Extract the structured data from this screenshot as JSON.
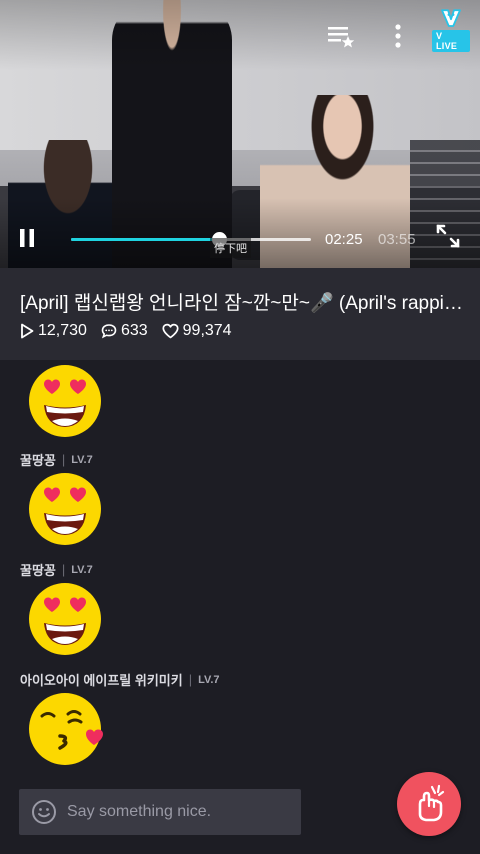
{
  "video": {
    "time_current": "02:25",
    "time_total": "03:55",
    "progress": 0.617,
    "subtitle": "停下吧",
    "logo_text": "V LIVE",
    "icons": {
      "playlist": "playlist-star-icon",
      "more": "more-vertical-icon",
      "pause": "pause-icon",
      "fullscreen": "fullscreen-icon"
    }
  },
  "info": {
    "title": "[April] 랩신랩왕 언니라인 잠~깐~만~🎤 (April's rapping queens)",
    "plays": "12,730",
    "comments": "633",
    "likes": "99,374"
  },
  "chat": {
    "messages": [
      {
        "user": "",
        "level": "",
        "emoji": "heart-eyes-emoji"
      },
      {
        "user": "꿀땅꽁",
        "level": "LV.7",
        "emoji": "heart-eyes-emoji"
      },
      {
        "user": "꿀땅꽁",
        "level": "LV.7",
        "emoji": "heart-eyes-emoji"
      },
      {
        "user": "아이오아이 에이프릴 위키미키",
        "level": "LV.7",
        "emoji": "kiss-heart-emoji"
      }
    ],
    "input_placeholder": "Say something nice."
  },
  "colors": {
    "accent": "#1fd3e0",
    "heart_button": "#f0525f",
    "background": "#1d1d24",
    "panel": "#2a2a32"
  }
}
